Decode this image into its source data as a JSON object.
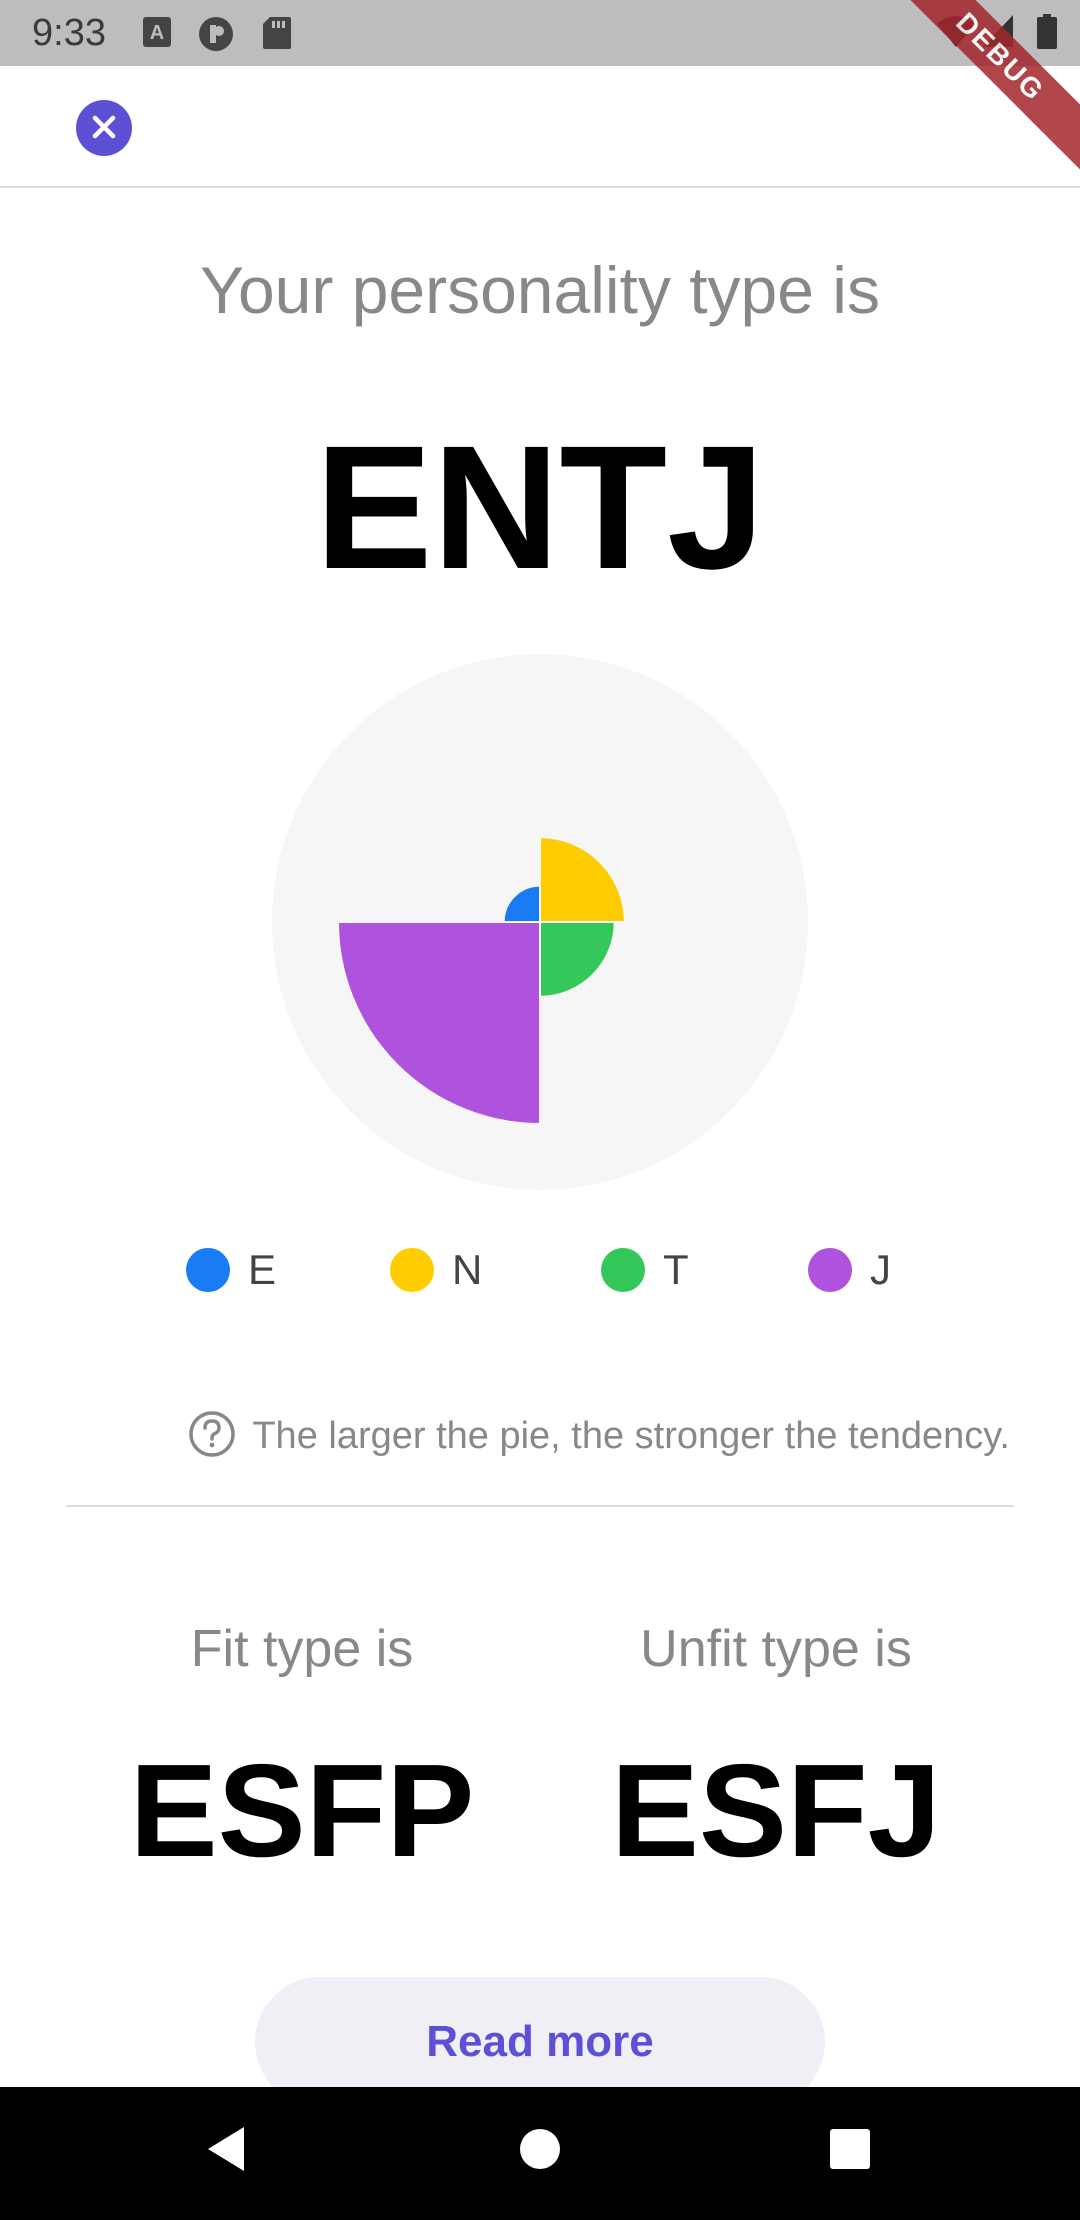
{
  "status_bar": {
    "time": "9:33",
    "left_icons": [
      "keyboard-a-icon",
      "flow-icon",
      "sd-card-icon"
    ],
    "right_icons": [
      "wifi-icon",
      "signal-icon",
      "battery-icon"
    ]
  },
  "debug_banner": "DEBUG",
  "app_bar": {
    "close_icon": "close-icon",
    "close_color": "#5b50d6"
  },
  "result": {
    "headline": "Your personality type is",
    "type_code": "ENTJ"
  },
  "chart_data": {
    "type": "pie",
    "categories": [
      "E",
      "N",
      "T",
      "J"
    ],
    "values": [
      0.18,
      0.42,
      0.37,
      1.0
    ],
    "colors": [
      "#1a7cf5",
      "#ffcc00",
      "#34c759",
      "#af52de"
    ],
    "note": "Each quarter's radius shows tendency strength"
  },
  "legend": [
    {
      "label": "E",
      "color": "#1a7cf5"
    },
    {
      "label": "N",
      "color": "#ffcc00"
    },
    {
      "label": "T",
      "color": "#34c759"
    },
    {
      "label": "J",
      "color": "#af52de"
    }
  ],
  "hint": {
    "icon": "question-circle-icon",
    "text": "The larger the pie, the stronger the tendency."
  },
  "fit": {
    "label": "Fit type is",
    "value": "ESFP"
  },
  "unfit": {
    "label": "Unfit type is",
    "value": "ESFJ"
  },
  "read_more_label": "Read more",
  "nav_bar": {
    "icons": [
      "back-icon",
      "home-icon",
      "recents-icon"
    ]
  }
}
